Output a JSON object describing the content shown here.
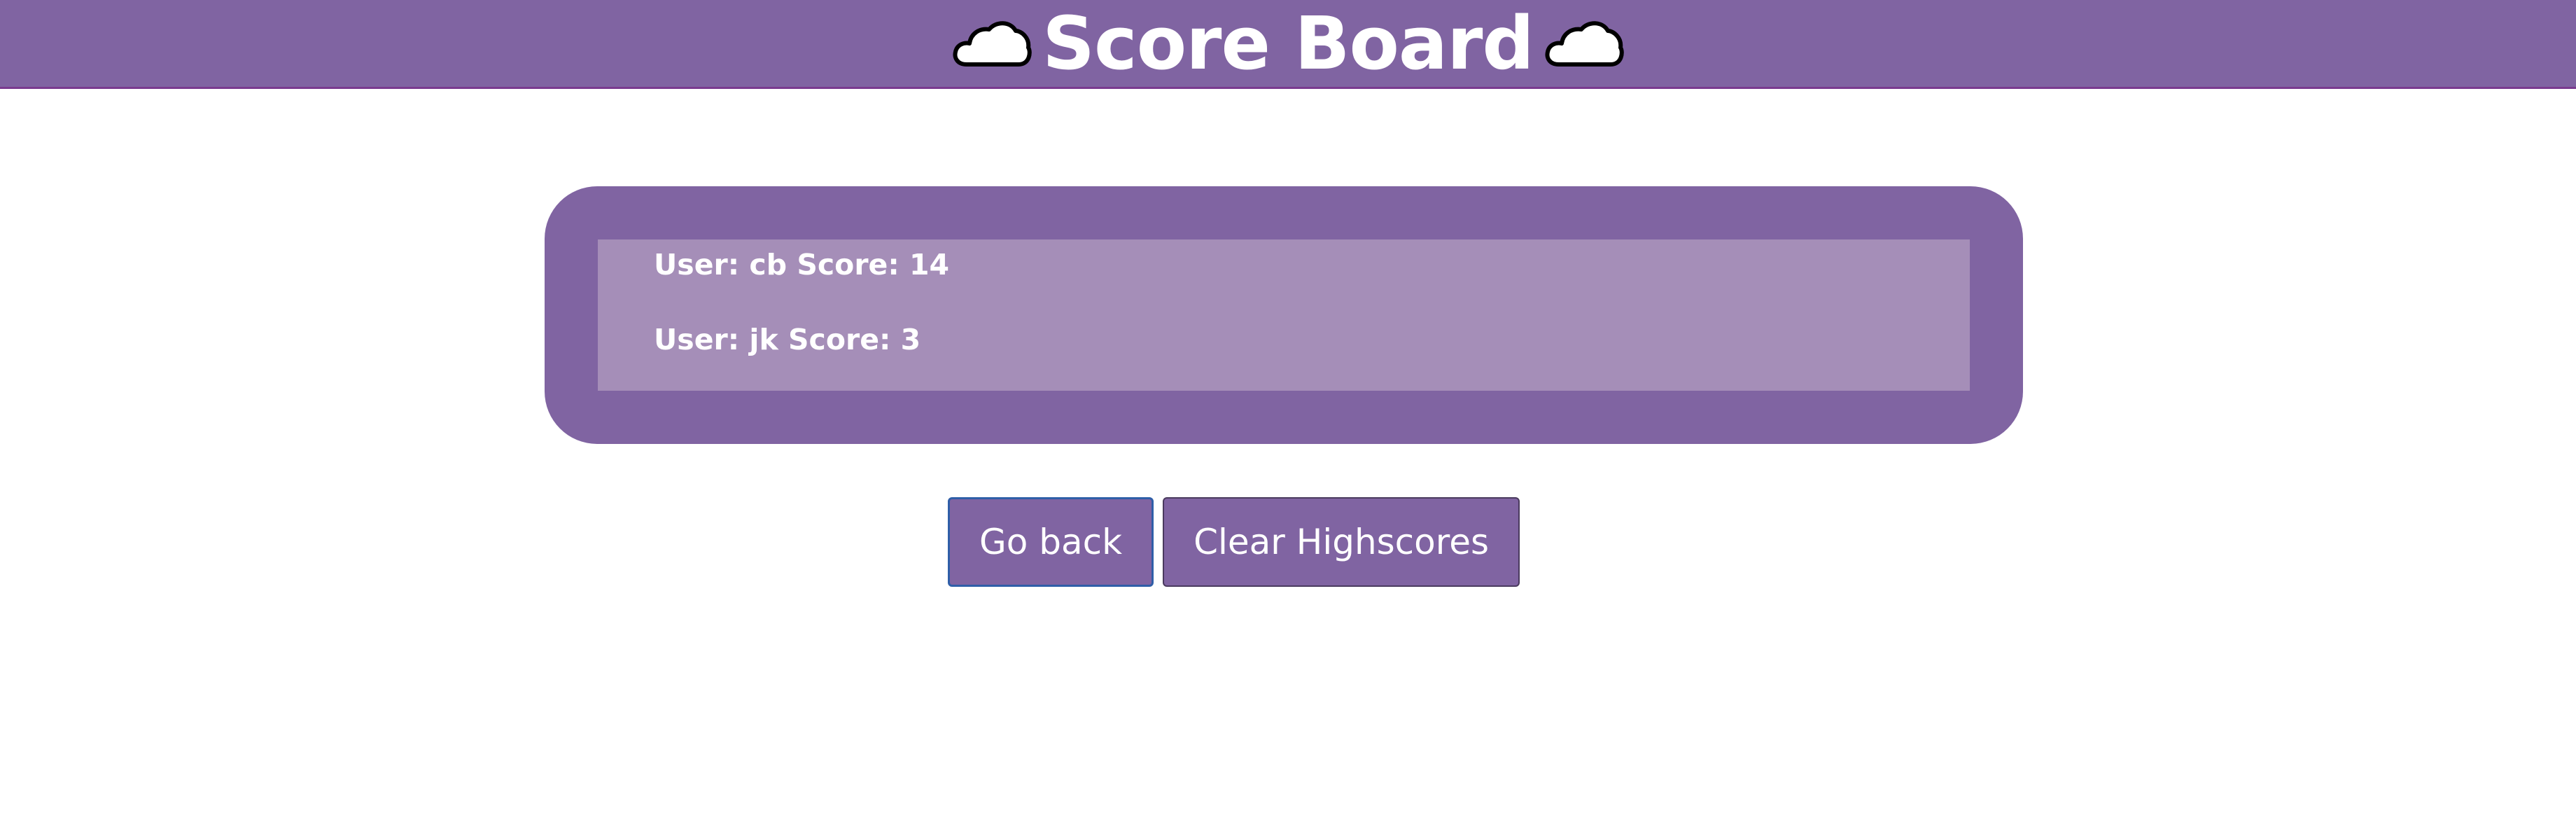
{
  "header": {
    "title": "Score Board",
    "left_icon": "cloud-icon",
    "right_icon": "cloud-icon",
    "background": "#8064a2"
  },
  "scores": [
    {
      "text": "User: cb Score: 14"
    },
    {
      "text": "User: jk Score: 3"
    }
  ],
  "buttons": {
    "go_back": "Go back",
    "clear": "Clear Highscores"
  },
  "colors": {
    "accent": "#8064a2",
    "list_background": "#a58eb8",
    "text": "#ffffff"
  }
}
